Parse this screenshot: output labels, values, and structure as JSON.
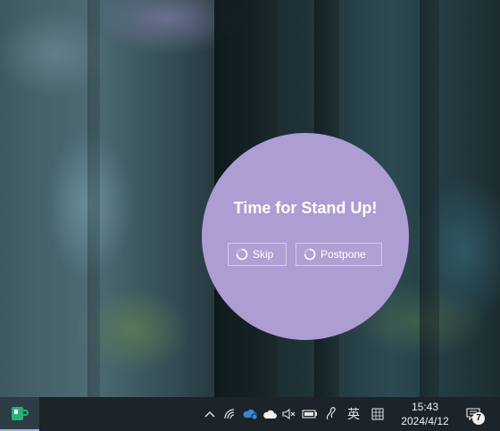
{
  "reminder": {
    "title": "Time for Stand Up!",
    "skip_label": "Skip",
    "postpone_label": "Postpone",
    "background_color": "#ad9dd2"
  },
  "taskbar": {
    "pinned_app_icon": "green-mug-app-icon",
    "ime_label": "英",
    "time": "15:43",
    "date": "2024/4/12",
    "notification_count": "7",
    "tray_icons": [
      "chevron-up-icon",
      "network-icon",
      "onedrive-sync-icon",
      "cloud-icon",
      "speaker-muted-icon",
      "battery-icon",
      "pen-icon",
      "ime-mode-icon",
      "notification-icon"
    ]
  }
}
